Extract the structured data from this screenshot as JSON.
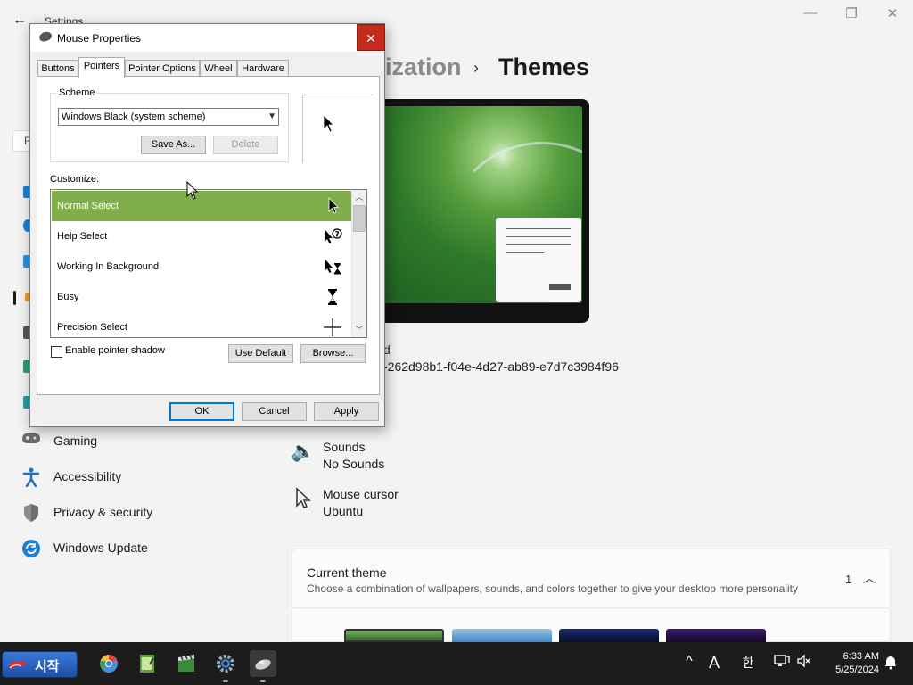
{
  "settings": {
    "window_title": "Settings",
    "breadcrumb_parent": "ization",
    "breadcrumb_current": "Themes",
    "theme_id_label": "d",
    "theme_id_value": "-262d98b1-f04e-4d27-ab89-e7d7c3984f96",
    "sounds_title": "Sounds",
    "sounds_value": "No Sounds",
    "cursor_title": "Mouse cursor",
    "cursor_value": "Ubuntu",
    "nav": [
      {
        "label": "Gaming"
      },
      {
        "label": "Accessibility"
      },
      {
        "label": "Privacy & security"
      },
      {
        "label": "Windows Update"
      }
    ],
    "current_theme_title": "Current theme",
    "current_theme_desc": "Choose a combination of wallpapers, sounds, and colors together to give your desktop more personality",
    "current_theme_count": "1",
    "search_stub": "F"
  },
  "dialog": {
    "title": "Mouse Properties",
    "tabs": [
      {
        "label": "Buttons"
      },
      {
        "label": "Pointers"
      },
      {
        "label": "Pointer Options"
      },
      {
        "label": "Wheel"
      },
      {
        "label": "Hardware"
      }
    ],
    "scheme_label": "Scheme",
    "scheme_value": "Windows Black (system scheme)",
    "save_as_label": "Save As...",
    "delete_label": "Delete",
    "customize_label": "Customize:",
    "pointers": [
      {
        "label": "Normal Select",
        "icon": "arrow-cursor-icon"
      },
      {
        "label": "Help Select",
        "icon": "help-cursor-icon"
      },
      {
        "label": "Working In Background",
        "icon": "working-cursor-icon"
      },
      {
        "label": "Busy",
        "icon": "hourglass-cursor-icon"
      },
      {
        "label": "Precision Select",
        "icon": "crosshair-cursor-icon"
      }
    ],
    "shadow_label": "Enable pointer shadow",
    "use_default_label": "Use Default",
    "browse_label": "Browse...",
    "ok_label": "OK",
    "cancel_label": "Cancel",
    "apply_label": "Apply",
    "selection_color": "#7fae4a"
  },
  "taskbar": {
    "start_label": "시작",
    "ime_label": "한",
    "font_label": "A",
    "time": "6:33 AM",
    "date": "5/25/2024"
  }
}
